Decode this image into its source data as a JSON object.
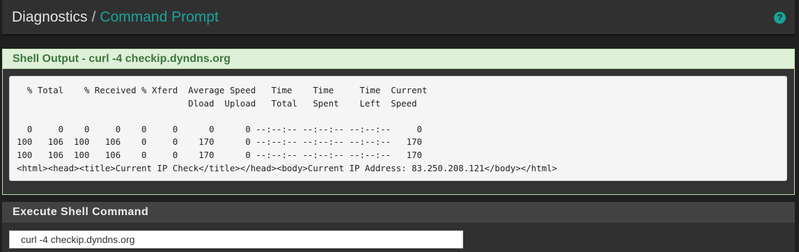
{
  "header": {
    "breadcrumb_root": "Diagnostics",
    "breadcrumb_separator": "/",
    "breadcrumb_current": "Command Prompt",
    "help_icon": "question-circle-icon",
    "help_glyph": "?"
  },
  "shell_output": {
    "title": "Shell Output - curl -4 checkip.dyndns.org",
    "lines": [
      "  % Total    % Received % Xferd  Average Speed   Time    Time     Time  Current",
      "                                 Dload  Upload   Total   Spent    Left  Speed",
      "",
      "  0     0    0     0    0     0      0      0 --:--:-- --:--:-- --:--:--     0",
      "100   106  100   106    0     0    170      0 --:--:-- --:--:-- --:--:--   170",
      "100   106  100   106    0     0    170      0 --:--:-- --:--:-- --:--:--   170",
      "<html><head><title>Current IP Check</title></head><body>Current IP Address: 83.250.208.121</body></html>"
    ]
  },
  "execute": {
    "title": "Execute Shell Command",
    "command_value": "curl -4 checkip.dyndns.org"
  },
  "colors": {
    "accent": "#1ba39c",
    "success_bg": "#dff0d8",
    "success_text": "#3c763d",
    "panel_bg": "#303030"
  }
}
